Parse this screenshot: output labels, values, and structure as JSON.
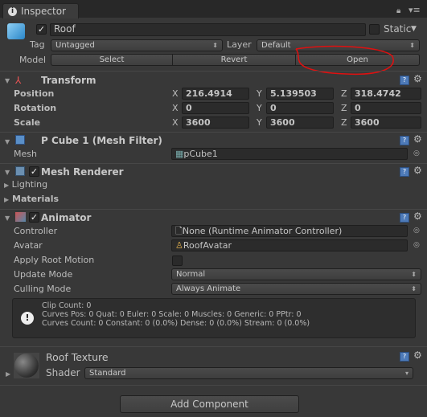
{
  "tab": {
    "title": "Inspector"
  },
  "header": {
    "name": "Roof",
    "active": true,
    "static_label": "Static",
    "static": false,
    "tag_label": "Tag",
    "tag": "Untagged",
    "layer_label": "Layer",
    "layer": "Default",
    "model_label": "Model",
    "select": "Select",
    "revert": "Revert",
    "open": "Open",
    "annotation_color": "#e01010"
  },
  "transform": {
    "title": "Transform",
    "rows": [
      {
        "label": "Position",
        "x": "216.4914",
        "y": "5.139503",
        "z": "318.4742"
      },
      {
        "label": "Rotation",
        "x": "0",
        "y": "0",
        "z": "0"
      },
      {
        "label": "Scale",
        "x": "3600",
        "y": "3600",
        "z": "3600"
      }
    ]
  },
  "axes": {
    "x": "X",
    "y": "Y",
    "z": "Z"
  },
  "mesh_filter": {
    "title": "P Cube 1 (Mesh Filter)",
    "mesh_label": "Mesh",
    "mesh": "pCube1"
  },
  "mesh_renderer": {
    "title": "Mesh Renderer",
    "enabled": true,
    "lighting": "Lighting",
    "materials": "Materials"
  },
  "animator": {
    "title": "Animator",
    "enabled": true,
    "controller_label": "Controller",
    "controller": "None (Runtime Animator Controller)",
    "avatar_label": "Avatar",
    "avatar": "RoofAvatar",
    "root_motion_label": "Apply Root Motion",
    "root_motion": false,
    "update_label": "Update Mode",
    "update": "Normal",
    "culling_label": "Culling Mode",
    "culling": "Always Animate",
    "info": [
      "Clip Count: 0",
      "Curves Pos: 0 Quat: 0 Euler: 0 Scale: 0 Muscles: 0 Generic: 0 PPtr: 0",
      "Curves Count: 0 Constant: 0 (0.0%) Dense: 0 (0.0%) Stream: 0 (0.0%)"
    ]
  },
  "material": {
    "title": "Roof Texture",
    "shader_label": "Shader",
    "shader": "Standard"
  },
  "add_component": "Add Component"
}
